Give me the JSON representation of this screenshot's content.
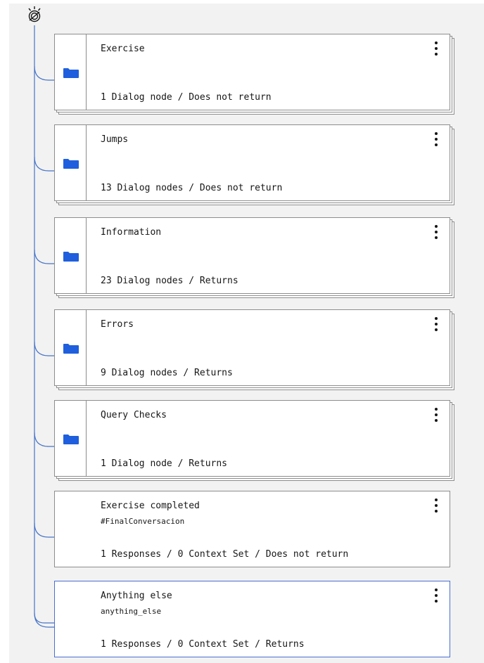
{
  "colors": {
    "tree_line": "#4674c7",
    "folder": "#1f5fdd",
    "selected_border": "#4a6fd3",
    "card_border": "#8d8d8d"
  },
  "root": {
    "icon": "welcome-sun-icon"
  },
  "nodes": [
    {
      "type": "folder",
      "title": "Exercise",
      "subtitle": "",
      "meta": "1 Dialog node / Does not return",
      "selected": false
    },
    {
      "type": "folder",
      "title": "Jumps",
      "subtitle": "",
      "meta": "13 Dialog nodes / Does not return",
      "selected": false
    },
    {
      "type": "folder",
      "title": "Information",
      "subtitle": "",
      "meta": "23 Dialog nodes / Returns",
      "selected": false
    },
    {
      "type": "folder",
      "title": "Errors",
      "subtitle": "",
      "meta": "9 Dialog nodes / Returns",
      "selected": false
    },
    {
      "type": "folder",
      "title": "Query Checks",
      "subtitle": "",
      "meta": "1 Dialog node / Returns",
      "selected": false
    },
    {
      "type": "node",
      "title": "Exercise completed",
      "subtitle": "#FinalConversacion",
      "meta": "1 Responses / 0 Context Set / Does not return",
      "selected": false
    },
    {
      "type": "node",
      "title": "Anything else",
      "subtitle": "anything_else",
      "meta": "1 Responses / 0 Context Set / Returns",
      "selected": true
    }
  ]
}
